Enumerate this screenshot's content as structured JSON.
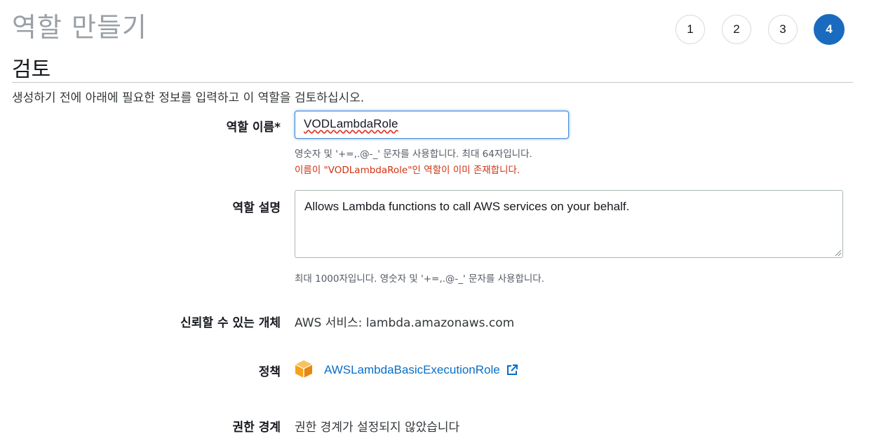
{
  "header": {
    "title": "역할 만들기",
    "steps": [
      "1",
      "2",
      "3",
      "4"
    ],
    "active_step": "4"
  },
  "section": {
    "title": "검토",
    "intro": "생성하기 전에 아래에 필요한 정보를 입력하고 이 역할을 검토하십시오."
  },
  "role_name": {
    "label": "역할 이름*",
    "value": "VODLambdaRole",
    "hint": "영숫자 및 '+=,.@-_' 문자를 사용합니다. 최대 64자입니다.",
    "error": "이름이 \"VODLambdaRole\"인 역할이 이미 존재합니다."
  },
  "role_description": {
    "label": "역할 설명",
    "value": "Allows Lambda functions to call AWS services on your behalf.",
    "hint": "최대 1000자입니다. 영숫자 및 '+=,.@-_' 문자를 사용합니다."
  },
  "trusted_entity": {
    "label": "신뢰할 수 있는 개체",
    "value": "AWS 서비스: lambda.amazonaws.com"
  },
  "policies": {
    "label": "정책",
    "icon": "aws-cube-icon",
    "items": [
      "AWSLambdaBasicExecutionRole"
    ],
    "link_icon": "external-link-icon"
  },
  "permissions_boundary": {
    "label": "권한 경계",
    "value": "권한 경계가 설정되지 않았습니다"
  },
  "colors": {
    "accent": "#1a6bbf",
    "link": "#0a6ec7",
    "error": "#d13212",
    "policy_icon": "#f7a21b"
  }
}
